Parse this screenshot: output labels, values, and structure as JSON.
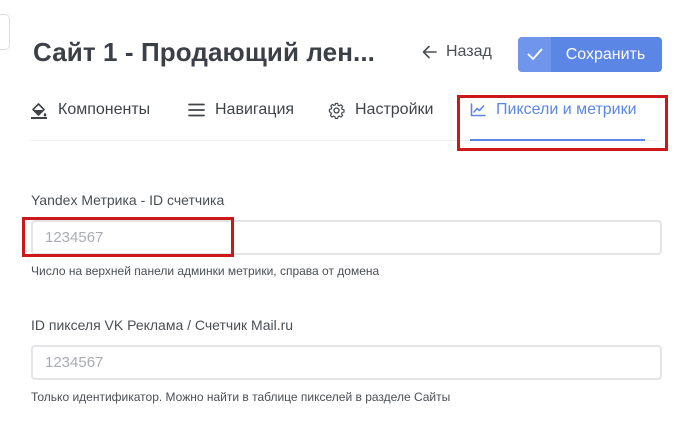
{
  "header": {
    "title": "Сайт 1 - Продающий лен...",
    "back_label": "Назад",
    "save_label": "Сохранить"
  },
  "tabs": [
    {
      "label": "Компоненты",
      "icon": "paint-bucket-icon",
      "active": false
    },
    {
      "label": "Навигация",
      "icon": "menu-lines-icon",
      "active": false
    },
    {
      "label": "Настройки",
      "icon": "gear-icon",
      "active": false
    },
    {
      "label": "Пиксели и метрики",
      "icon": "line-chart-icon",
      "active": true
    }
  ],
  "fields": [
    {
      "label": "Yandex Метрика - ID счетчика",
      "value": "",
      "placeholder": "1234567",
      "hint": "Число на верхней панели админки метрики, справа от домена"
    },
    {
      "label": "ID пикселя VK Реклама / Счетчик Mail.ru",
      "value": "",
      "placeholder": "1234567",
      "hint": "Только идентификатор. Можно найти в таблице пикселей в разделе Сайты"
    }
  ],
  "colors": {
    "accent": "#5b86e5",
    "highlight": "#cc1818",
    "text": "#3a3f45"
  }
}
